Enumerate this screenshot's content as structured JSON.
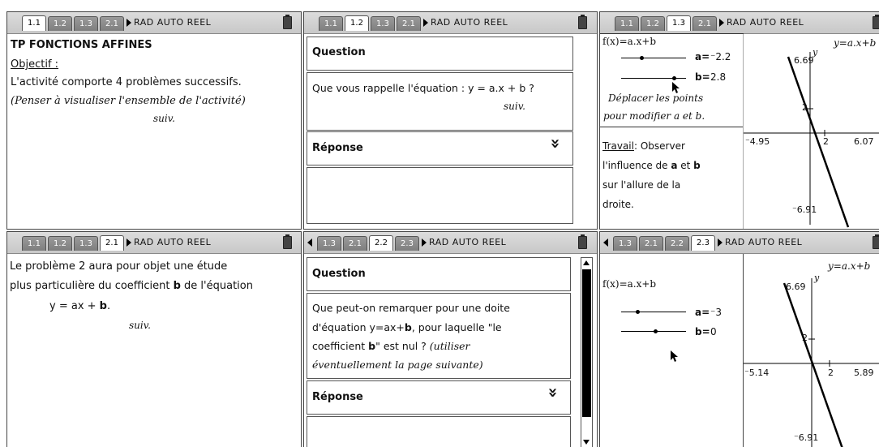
{
  "panes": {
    "p1": {
      "tabs": [
        "1.1",
        "1.2",
        "1.3",
        "2.1"
      ],
      "status": "RAD AUTO REEL",
      "title": "TP FONCTIONS AFFINES",
      "objectif": "Objectif :",
      "line1": "L'activité comporte 4 problèmes successifs.",
      "line2": "(Penser à visualiser l'ensemble de l'activité)",
      "suiv": "suiv."
    },
    "p2": {
      "tabs": [
        "1.1",
        "1.2",
        "1.3",
        "2.1"
      ],
      "status": "RAD AUTO REEL",
      "question_label": "Question",
      "question_text": "Que vous rappelle l'équation : y = a.x + b ?",
      "suiv": "suiv.",
      "reponse_label": "Réponse",
      "chevron": "»"
    },
    "p3": {
      "tabs": [
        "1.1",
        "1.2",
        "1.3",
        "2.1"
      ],
      "status": "RAD AUTO REEL",
      "fx": "f(x)=a.x+b",
      "a_label": "a=",
      "a_value": "⁻2.2",
      "b_label": "b=",
      "b_value": "2.8",
      "hint1": "Déplacer les points",
      "hint2": "pour modifier a et b.",
      "travail_label": "Travail",
      "travail_rest": ": Observer",
      "t2a": "l'influence de ",
      "t2b": "a",
      "t2c": " et ",
      "t2d": "b",
      "t3": "sur l'allure de la",
      "t4": "droite.",
      "graph": {
        "eq": "y=a.x+b",
        "ylabel": "y",
        "ymax": "6.69",
        "ymin": "⁻6.91",
        "xmin": "⁻4.95",
        "xmax": "6.07",
        "tick_y": "2",
        "tick_x": "2"
      }
    },
    "p4": {
      "tabs": [
        "1.1",
        "1.2",
        "1.3",
        "2.1"
      ],
      "status": "RAD AUTO REEL",
      "l1": "Le problème 2 aura pour objet une étude",
      "l2a": "plus particulière du coefficient ",
      "l2b": "b",
      "l2c": " de l'équation",
      "l3a": "y = ax + ",
      "l3b": "b",
      "l3c": ".",
      "suiv": "suiv."
    },
    "p5": {
      "tabs": [
        "1.3",
        "2.1",
        "2.2",
        "2.3"
      ],
      "status": "RAD AUTO REEL",
      "question_label": "Question",
      "q1": "Que peut-on remarquer pour une doite",
      "q2a": "d'équation y=ax+",
      "q2b": "b",
      "q2c": ", pour laquelle \"le",
      "q3a": "coefficient ",
      "q3b": "b",
      "q3c": "\" est nul ? ",
      "q3d": "(utiliser",
      "q4": "éventuellement la page suivante)",
      "reponse_label": "Réponse",
      "chevron": "»"
    },
    "p6": {
      "tabs": [
        "1.3",
        "2.1",
        "2.2",
        "2.3"
      ],
      "status": "RAD AUTO REEL",
      "fx": "f(x)=a.x+b",
      "a_label": "a=",
      "a_value": "⁻3",
      "b_label": "b=",
      "b_value": "0",
      "graph": {
        "eq": "y=a.x+b",
        "ylabel": "y",
        "ymax": "6.69",
        "ymin": "⁻6.91",
        "xmin": "⁻5.14",
        "xmax": "5.89",
        "tick_x": "2",
        "tick_y": "2"
      }
    }
  }
}
